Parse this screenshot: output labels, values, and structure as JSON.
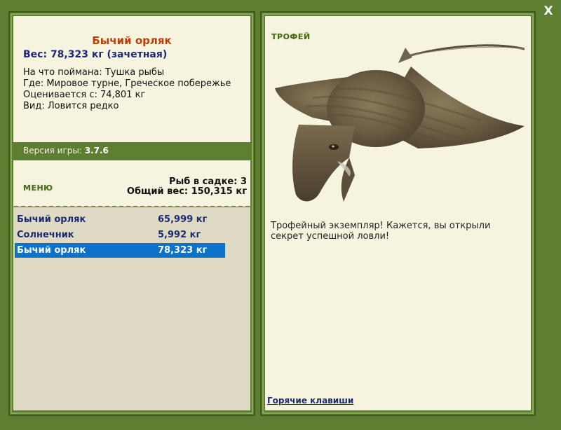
{
  "close_label": "X",
  "fish": {
    "title": "Бычий орляк",
    "weight_line": "Вес: 78,323 кг (зачетная)",
    "details": [
      "На что поймана: Тушка рыбы",
      "Где: Мировое турне, Греческое побережье",
      "Оценивается с: 74,801 кг",
      "Вид: Ловится редко"
    ]
  },
  "version": {
    "label": "Версия игры:",
    "value": "3.7.6"
  },
  "menu_label": "МЕНЮ",
  "tank": {
    "count": "Рыб в садке: 3",
    "total": "Общий вес: 150,315 кг"
  },
  "catch_list": [
    {
      "name": "Бычий орляк",
      "weight": "65,999 кг"
    },
    {
      "name": "Солнечник",
      "weight": "5,992 кг"
    },
    {
      "name": "Бычий орляк",
      "weight": "78,323 кг"
    }
  ],
  "selected_index": 2,
  "trophy": {
    "label": "ТРОФЕЙ",
    "text": "Трофейный экземпляр! Кажется, вы открыли секрет успешной ловли!"
  },
  "hotkeys_label": "Горячие клавиши",
  "colors": {
    "frame_green": "#5e7e32",
    "panel_bg": "#f6f3de",
    "title_orange": "#b8400c",
    "text_navy": "#1e2a76",
    "selection_blue": "#0a72c8"
  }
}
